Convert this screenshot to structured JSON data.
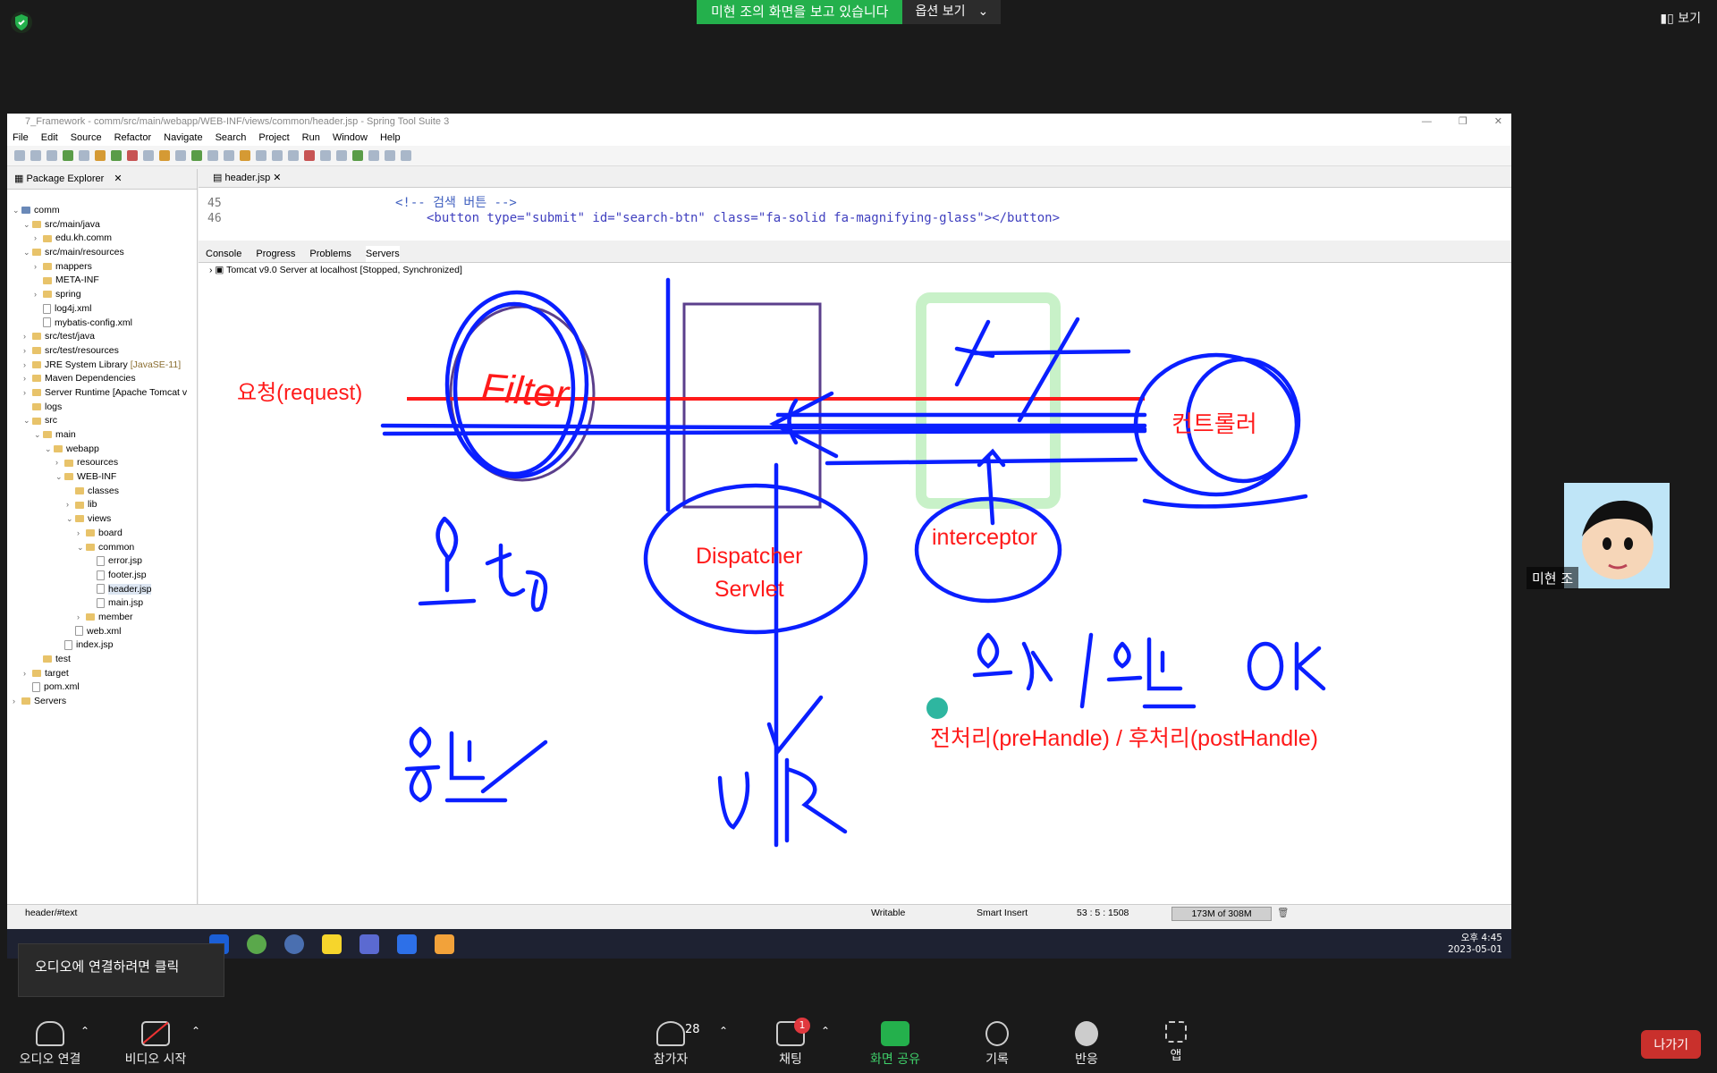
{
  "zoom": {
    "share_banner": "미현 조의 화면을 보고 있습니다",
    "options_label": "옵션 보기",
    "view_label": "보기",
    "participant_name": "미현 조",
    "tooltip": "오디오에 연결하려면 클릭",
    "leave_label": "나가기",
    "controls": [
      {
        "label": "오디오 연결"
      },
      {
        "label": "비디오 시작"
      },
      {
        "label": "참가자",
        "count": "28"
      },
      {
        "label": "채팅",
        "badge": "1"
      },
      {
        "label": "화면 공유"
      },
      {
        "label": "기록"
      },
      {
        "label": "반응"
      },
      {
        "label": "앱"
      }
    ]
  },
  "ide": {
    "title": "7_Framework - comm/src/main/webapp/WEB-INF/views/common/header.jsp - Spring Tool Suite 3",
    "menu": [
      "File",
      "Edit",
      "Source",
      "Refactor",
      "Navigate",
      "Search",
      "Project",
      "Run",
      "Window",
      "Help"
    ],
    "explorer_tab": "Package Explorer",
    "editor_tab": "header.jsp",
    "code_lines": [
      {
        "num": "45",
        "text": "<!-- 검색 버튼 -->"
      },
      {
        "num": "46",
        "text": "<button type=\"submit\" id=\"search-btn\" class=\"fa-solid fa-magnifying-glass\"></button>"
      }
    ],
    "bottom_tabs": [
      "Console",
      "Progress",
      "Problems",
      "Servers"
    ],
    "server_row": "Tomcat v9.0 Server at localhost  [Stopped, Synchronized]",
    "status": {
      "path": "header/#text",
      "writable": "Writable",
      "insert": "Smart Insert",
      "position": "53 : 5 : 1508",
      "memory": "173M of 308M"
    },
    "tree": [
      {
        "label": "comm",
        "indent": 0,
        "tw": "v",
        "icon": "proj"
      },
      {
        "label": "src/main/java",
        "indent": 1,
        "tw": "v",
        "icon": "pkg"
      },
      {
        "label": "edu.kh.comm",
        "indent": 2,
        "tw": ">",
        "icon": "pkg"
      },
      {
        "label": "src/main/resources",
        "indent": 1,
        "tw": "v",
        "icon": "pkg"
      },
      {
        "label": "mappers",
        "indent": 2,
        "tw": ">",
        "icon": "folder"
      },
      {
        "label": "META-INF",
        "indent": 2,
        "tw": "",
        "icon": "folder"
      },
      {
        "label": "spring",
        "indent": 2,
        "tw": ">",
        "icon": "folder"
      },
      {
        "label": "log4j.xml",
        "indent": 2,
        "tw": "",
        "icon": "file"
      },
      {
        "label": "mybatis-config.xml",
        "indent": 2,
        "tw": "",
        "icon": "file"
      },
      {
        "label": "src/test/java",
        "indent": 1,
        "tw": ">",
        "icon": "pkg"
      },
      {
        "label": "src/test/resources",
        "indent": 1,
        "tw": ">",
        "icon": "pkg"
      },
      {
        "label": "JRE System Library",
        "suffix": " [JavaSE-11]",
        "indent": 1,
        "tw": ">",
        "icon": "lib"
      },
      {
        "label": "Maven Dependencies",
        "indent": 1,
        "tw": ">",
        "icon": "lib"
      },
      {
        "label": "Server Runtime [Apache Tomcat v",
        "indent": 1,
        "tw": ">",
        "icon": "lib"
      },
      {
        "label": "logs",
        "indent": 1,
        "tw": "",
        "icon": "folder"
      },
      {
        "label": "src",
        "indent": 1,
        "tw": "v",
        "icon": "folder"
      },
      {
        "label": "main",
        "indent": 2,
        "tw": "v",
        "icon": "folder"
      },
      {
        "label": "webapp",
        "indent": 3,
        "tw": "v",
        "icon": "folder"
      },
      {
        "label": "resources",
        "indent": 4,
        "tw": ">",
        "icon": "folder"
      },
      {
        "label": "WEB-INF",
        "indent": 4,
        "tw": "v",
        "icon": "folder"
      },
      {
        "label": "classes",
        "indent": 5,
        "tw": "",
        "icon": "folder"
      },
      {
        "label": "lib",
        "indent": 5,
        "tw": ">",
        "icon": "folder"
      },
      {
        "label": "views",
        "indent": 5,
        "tw": "v",
        "icon": "folder"
      },
      {
        "label": "board",
        "indent": 6,
        "tw": ">",
        "icon": "folder"
      },
      {
        "label": "common",
        "indent": 6,
        "tw": "v",
        "icon": "folder"
      },
      {
        "label": "error.jsp",
        "indent": 7,
        "tw": "",
        "icon": "file"
      },
      {
        "label": "footer.jsp",
        "indent": 7,
        "tw": "",
        "icon": "file"
      },
      {
        "label": "header.jsp",
        "indent": 7,
        "tw": "",
        "icon": "file",
        "selected": true
      },
      {
        "label": "main.jsp",
        "indent": 7,
        "tw": "",
        "icon": "file"
      },
      {
        "label": "member",
        "indent": 6,
        "tw": ">",
        "icon": "folder"
      },
      {
        "label": "web.xml",
        "indent": 5,
        "tw": "",
        "icon": "file"
      },
      {
        "label": "index.jsp",
        "indent": 4,
        "tw": "",
        "icon": "file"
      },
      {
        "label": "test",
        "indent": 2,
        "tw": "",
        "icon": "folder"
      },
      {
        "label": "target",
        "indent": 1,
        "tw": ">",
        "icon": "folder"
      },
      {
        "label": "pom.xml",
        "indent": 1,
        "tw": "",
        "icon": "file"
      },
      {
        "label": "Servers",
        "indent": 0,
        "tw": ">",
        "icon": "folder"
      }
    ]
  },
  "whiteboard": {
    "request_label": "요청(request)",
    "filter_label": "Filter",
    "controller_label": "컨트롤러",
    "dispatcher_line1": "Dispatcher",
    "dispatcher_line2": "Servlet",
    "interceptor_label": "interceptor",
    "handle_label": "전처리(preHandle) / 후처리(postHandle)"
  },
  "taskbar": {
    "time": "오후 4:45",
    "date": "2023-05-01"
  },
  "colors": {
    "zoom_green": "#24b04c",
    "ink_blue": "#0a1fff",
    "ink_red": "#ff1a1a",
    "leave_red": "#c9302c"
  }
}
